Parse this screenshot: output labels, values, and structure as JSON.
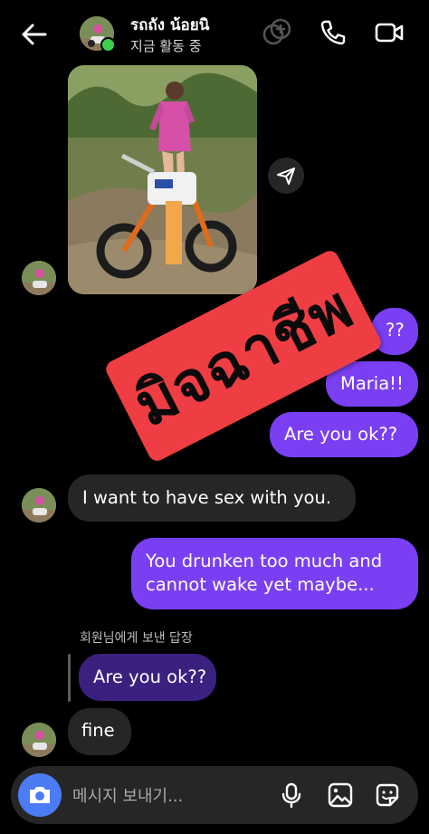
{
  "header": {
    "name": "รถถัง น้อยนิ",
    "status": "지금 활동 중"
  },
  "stamp": {
    "text": "มิจฉาชีพ",
    "color": "#ef3d44"
  },
  "messages": {
    "sent_partial": "??",
    "sent_maria": "Maria!!",
    "sent_are_you_ok": "Are you ok??",
    "recv_sex": "I want to have sex with you.",
    "sent_drunk_line1": "You drunken too much and",
    "sent_drunk_line2": "cannot wake yet maybe...",
    "reply_label": "회원님에게 보낸 답장",
    "reply_quote": "Are you ok??",
    "recv_fine": "fine"
  },
  "composer": {
    "placeholder": "메시지 보내기..."
  },
  "icons": {
    "back": "arrow-left-icon",
    "effects": "effects-icon",
    "phone": "phone-icon",
    "video": "video-camera-icon",
    "share": "paper-plane-icon",
    "camera": "camera-icon",
    "mic": "microphone-icon",
    "gallery": "image-icon",
    "sticker": "sticker-icon"
  },
  "colors": {
    "sent_bubble": "#7a3ff2",
    "received_bubble": "#262626",
    "online": "#3ccf4e",
    "camera_button": "#4b7bf5"
  }
}
